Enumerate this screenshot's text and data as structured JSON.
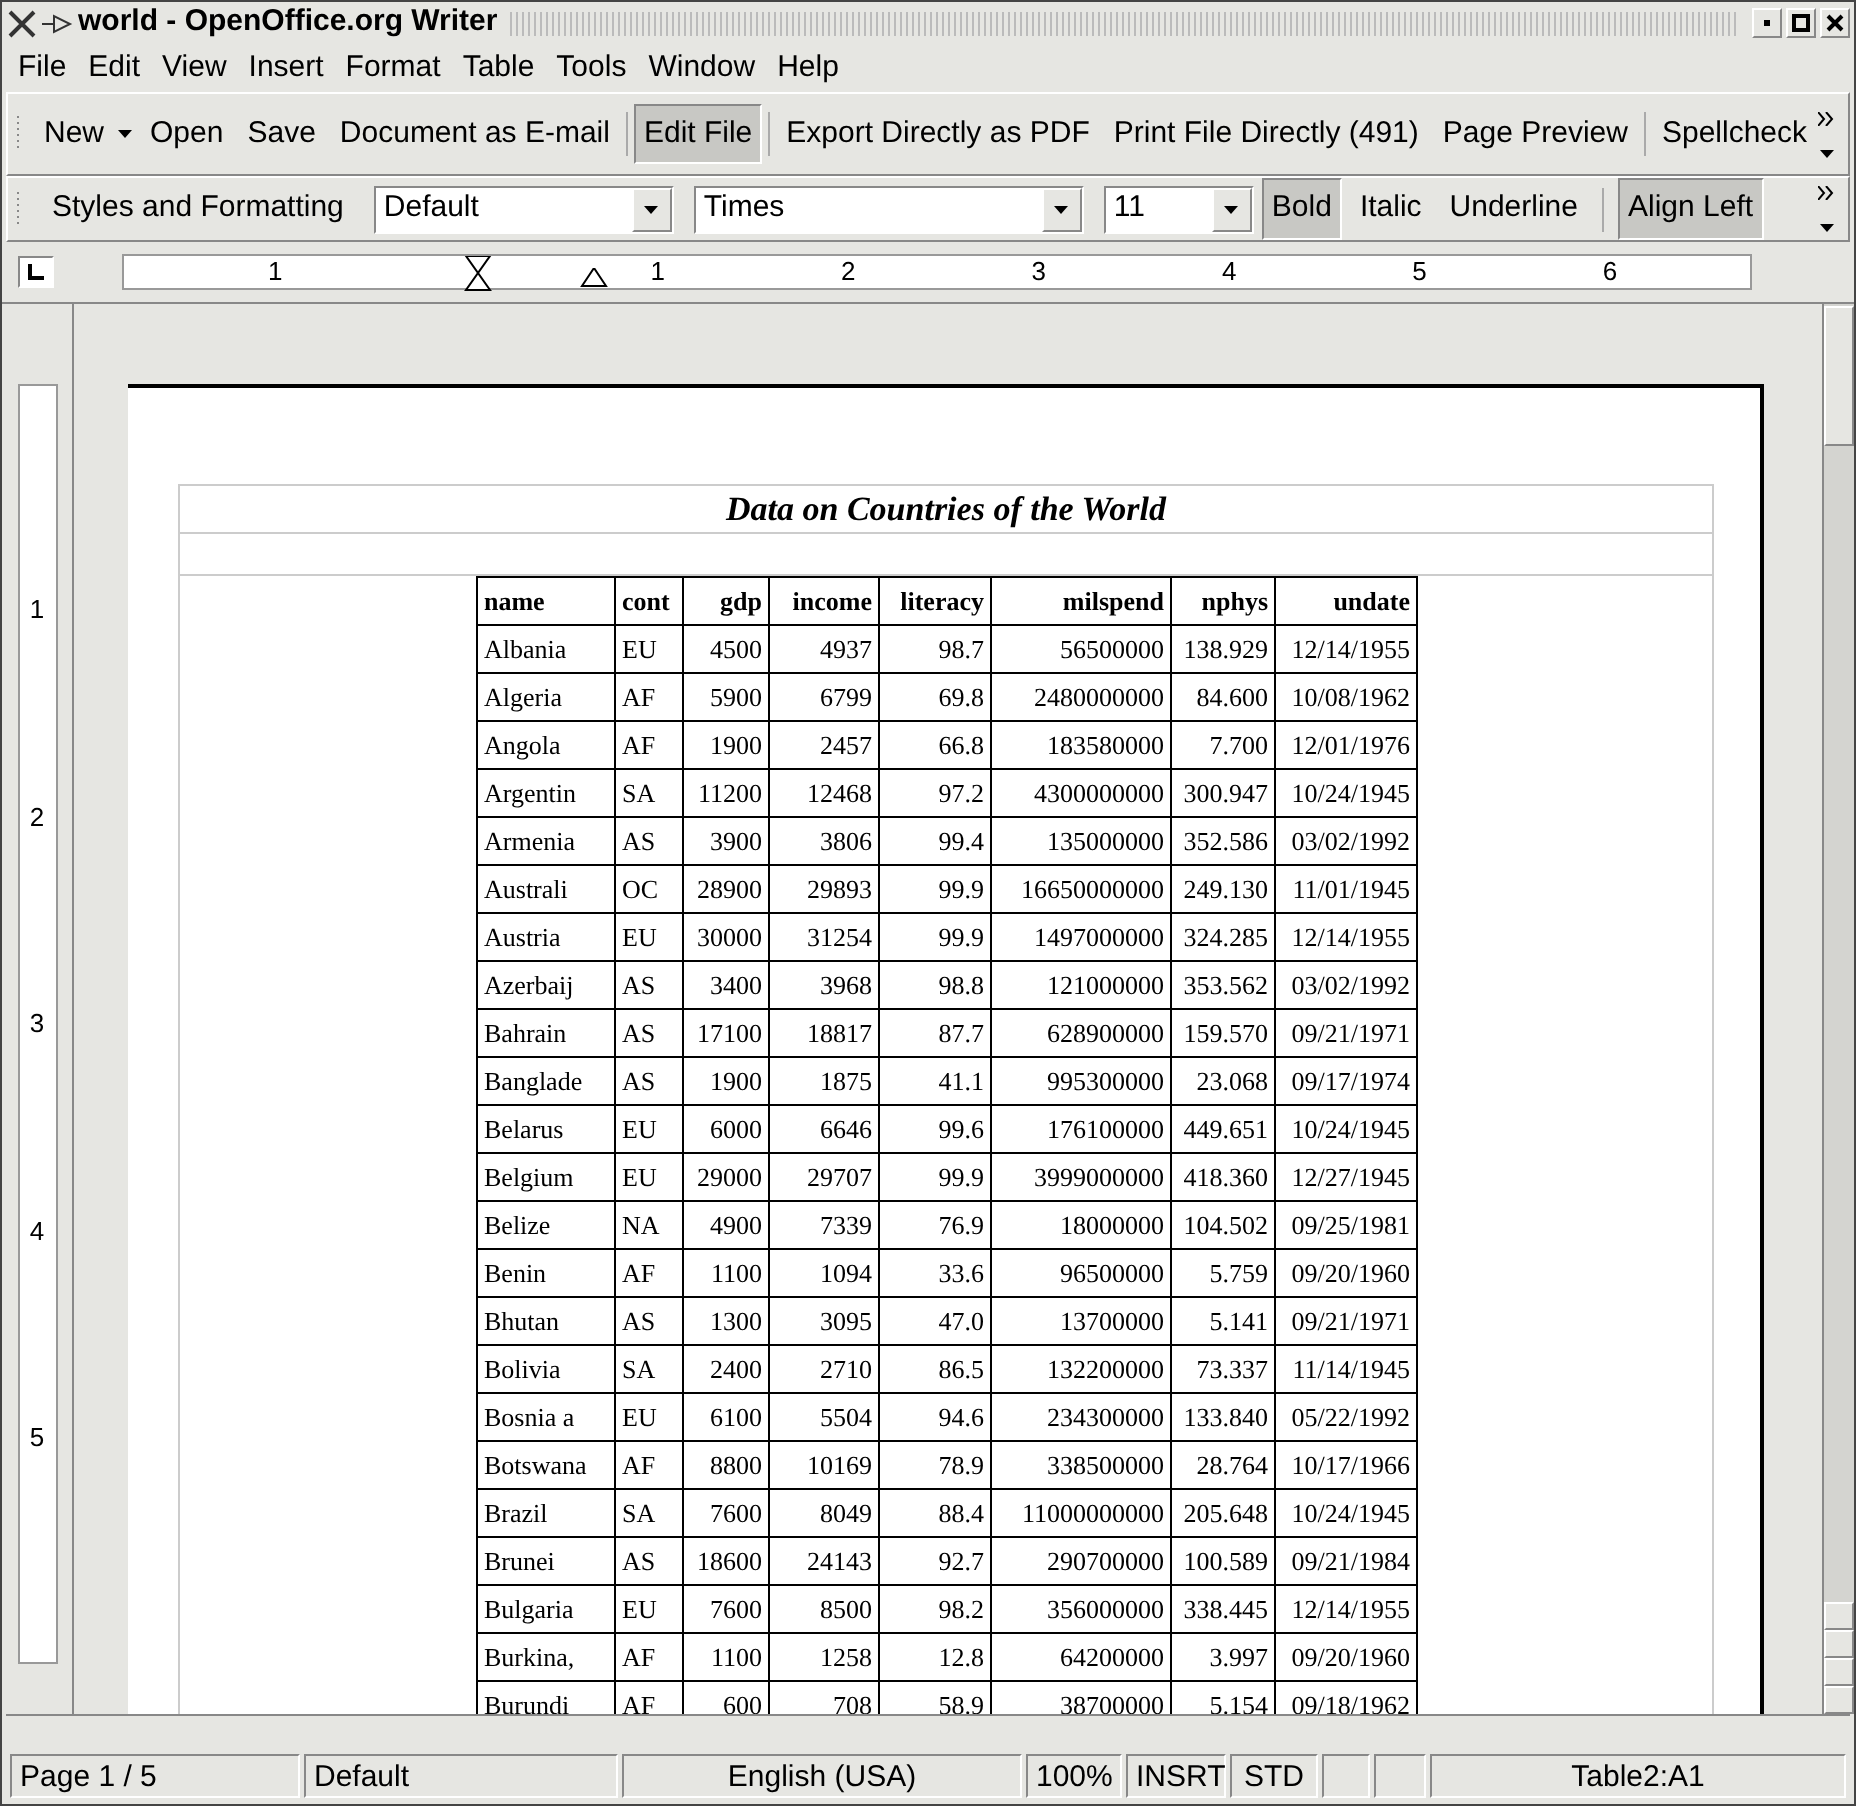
{
  "window": {
    "title": "world - OpenOffice.org Writer"
  },
  "menu": [
    "File",
    "Edit",
    "View",
    "Insert",
    "Format",
    "Table",
    "Tools",
    "Window",
    "Help"
  ],
  "toolbar_standard": {
    "groups": [
      [
        {
          "label": "New",
          "pressed": false,
          "dropdown": true
        },
        {
          "label": "Open",
          "pressed": false
        },
        {
          "label": "Save",
          "pressed": false
        },
        {
          "label": "Document as E-mail",
          "pressed": false
        }
      ],
      [
        {
          "label": "Edit File",
          "pressed": true
        }
      ],
      [
        {
          "label": "Export Directly as PDF",
          "pressed": false
        },
        {
          "label": "Print File Directly (491)",
          "pressed": false
        },
        {
          "label": "Page Preview",
          "pressed": false
        }
      ],
      [
        {
          "label": "Spellcheck",
          "pressed": false
        }
      ]
    ]
  },
  "toolbar_formatting": {
    "items": [
      {
        "kind": "button",
        "label": "Styles and Formatting",
        "pressed": false
      },
      {
        "kind": "combo",
        "value": "Default"
      },
      {
        "kind": "combo",
        "value": "Times"
      },
      {
        "kind": "combo",
        "value": "11"
      },
      {
        "kind": "button",
        "label": "Bold",
        "pressed": true
      },
      {
        "kind": "button",
        "label": "Italic",
        "pressed": false
      },
      {
        "kind": "button",
        "label": "Underline",
        "pressed": false
      },
      {
        "kind": "separator"
      },
      {
        "kind": "button",
        "label": "Align Left",
        "pressed": true
      }
    ]
  },
  "horizontal_ruler": [
    "1",
    "1",
    "2",
    "3",
    "4",
    "5",
    "6"
  ],
  "vertical_ruler": [
    "1",
    "2",
    "3",
    "4",
    "5"
  ],
  "document": {
    "title": "Data on Countries of the World",
    "columns": [
      "name",
      "cont",
      "gdp",
      "income",
      "literacy",
      "milspend",
      "nphys",
      "undate"
    ],
    "rows": [
      [
        "Albania",
        "EU",
        "4500",
        "4937",
        "98.7",
        "56500000",
        "138.929",
        "12/14/1955"
      ],
      [
        "Algeria",
        "AF",
        "5900",
        "6799",
        "69.8",
        "2480000000",
        "84.600",
        "10/08/1962"
      ],
      [
        "Angola",
        "AF",
        "1900",
        "2457",
        "66.8",
        "183580000",
        "7.700",
        "12/01/1976"
      ],
      [
        "Argentin",
        "SA",
        "11200",
        "12468",
        "97.2",
        "4300000000",
        "300.947",
        "10/24/1945"
      ],
      [
        "Armenia",
        "AS",
        "3900",
        "3806",
        "99.4",
        "135000000",
        "352.586",
        "03/02/1992"
      ],
      [
        "Australi",
        "OC",
        "28900",
        "29893",
        "99.9",
        "16650000000",
        "249.130",
        "11/01/1945"
      ],
      [
        "Austria",
        "EU",
        "30000",
        "31254",
        "99.9",
        "1497000000",
        "324.285",
        "12/14/1955"
      ],
      [
        "Azerbaij",
        "AS",
        "3400",
        "3968",
        "98.8",
        "121000000",
        "353.562",
        "03/02/1992"
      ],
      [
        "Bahrain",
        "AS",
        "17100",
        "18817",
        "87.7",
        "628900000",
        "159.570",
        "09/21/1971"
      ],
      [
        "Banglade",
        "AS",
        "1900",
        "1875",
        "41.1",
        "995300000",
        "23.068",
        "09/17/1974"
      ],
      [
        "Belarus",
        "EU",
        "6000",
        "6646",
        "99.6",
        "176100000",
        "449.651",
        "10/24/1945"
      ],
      [
        "Belgium",
        "EU",
        "29000",
        "29707",
        "99.9",
        "3999000000",
        "418.360",
        "12/27/1945"
      ],
      [
        "Belize",
        "NA",
        "4900",
        "7339",
        "76.9",
        "18000000",
        "104.502",
        "09/25/1981"
      ],
      [
        "Benin",
        "AF",
        "1100",
        "1094",
        "33.6",
        "96500000",
        "5.759",
        "09/20/1960"
      ],
      [
        "Bhutan",
        "AS",
        "1300",
        "3095",
        "47.0",
        "13700000",
        "5.141",
        "09/21/1971"
      ],
      [
        "Bolivia",
        "SA",
        "2400",
        "2710",
        "86.5",
        "132200000",
        "73.337",
        "11/14/1945"
      ],
      [
        "Bosnia a",
        "EU",
        "6100",
        "5504",
        "94.6",
        "234300000",
        "133.840",
        "05/22/1992"
      ],
      [
        "Botswana",
        "AF",
        "8800",
        "10169",
        "78.9",
        "338500000",
        "28.764",
        "10/17/1966"
      ],
      [
        "Brazil",
        "SA",
        "7600",
        "8049",
        "88.4",
        "11000000000",
        "205.648",
        "10/24/1945"
      ],
      [
        "Brunei",
        "AS",
        "18600",
        "24143",
        "92.7",
        "290700000",
        "100.589",
        "09/21/1984"
      ],
      [
        "Bulgaria",
        "EU",
        "7600",
        "8500",
        "98.2",
        "356000000",
        "338.445",
        "12/14/1955"
      ],
      [
        "Burkina,",
        "AF",
        "1100",
        "1258",
        "12.8",
        "64200000",
        "3.997",
        "09/20/1960"
      ],
      [
        "Burundi",
        "AF",
        "600",
        "708",
        "58.9",
        "38700000",
        "5.154",
        "09/18/1962"
      ]
    ]
  },
  "status_bar": [
    "Page 1 / 5",
    "Default",
    "English (USA)",
    "100%",
    "INSRT",
    "STD",
    "Table2:A1"
  ]
}
